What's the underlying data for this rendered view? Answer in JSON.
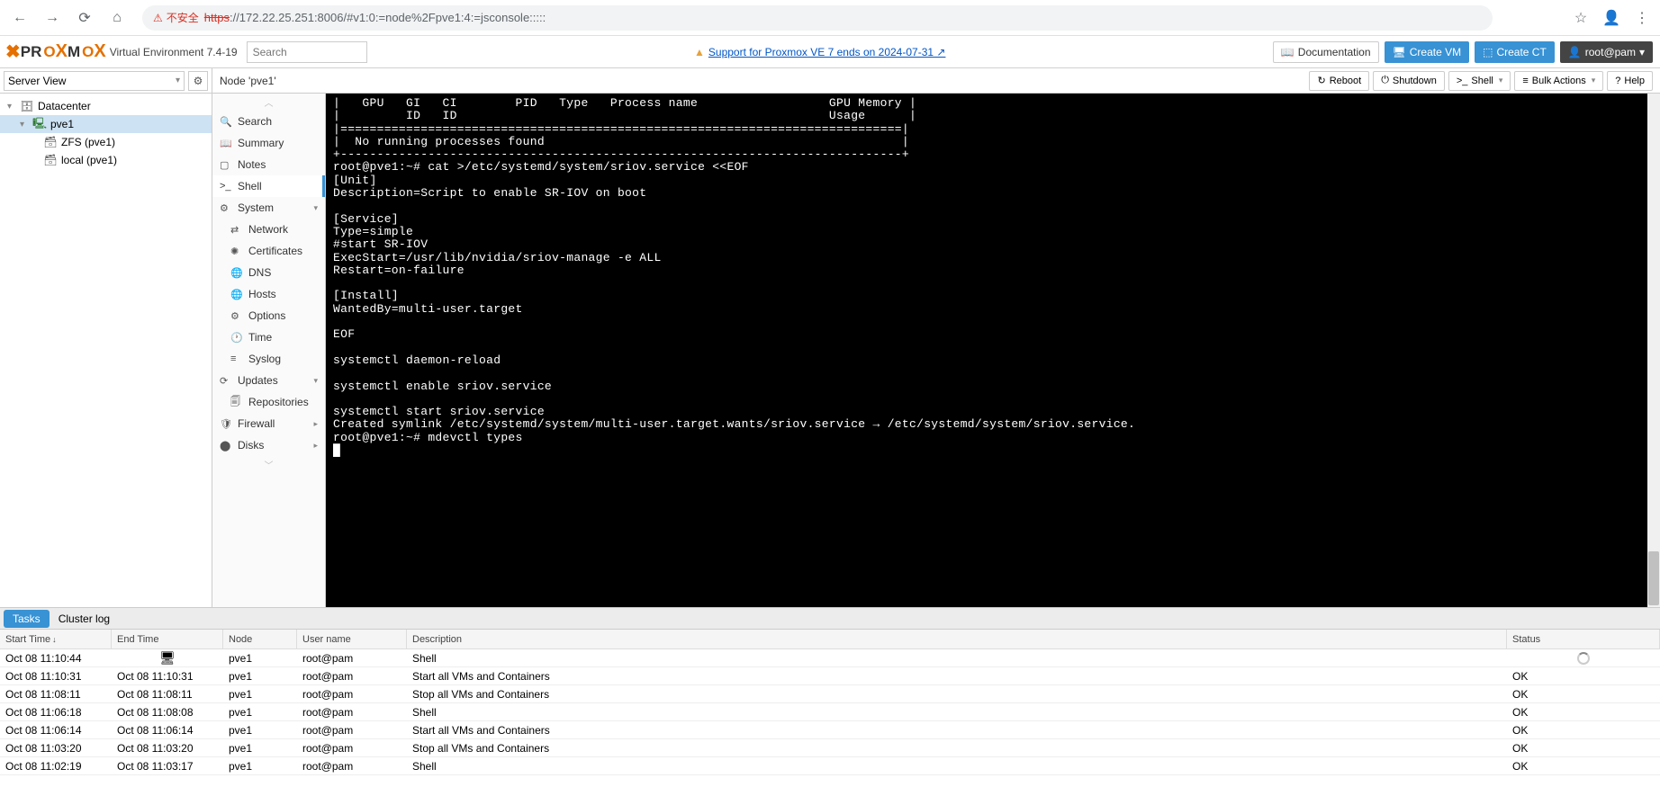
{
  "browser": {
    "insecure_label": "不安全",
    "url_scheme": "https",
    "url_rest": "://172.22.25.251:8006/#v1:0:=node%2Fpve1:4:=jsconsole:::::"
  },
  "header": {
    "logo_text_pre": "PR",
    "logo_text_o1": "O",
    "logo_text_x": "X",
    "logo_text_mid": "M",
    "logo_text_o2": "O",
    "logo_text_x2": "X",
    "product": "Virtual Environment",
    "version": "7.4-19",
    "search_placeholder": "Search",
    "support_warning": "Support for Proxmox VE 7 ends on 2024-07-31",
    "btn_docs": "Documentation",
    "btn_create_vm": "Create VM",
    "btn_create_ct": "Create CT",
    "user_label": "root@pam"
  },
  "sidebar": {
    "view_label": "Server View",
    "tree": {
      "datacenter": "Datacenter",
      "node": "pve1",
      "storage1": "ZFS (pve1)",
      "storage2": "local (pve1)"
    }
  },
  "center": {
    "title": "Node 'pve1'",
    "actions": {
      "reboot": "Reboot",
      "shutdown": "Shutdown",
      "shell": "Shell",
      "bulk": "Bulk Actions",
      "help": "Help"
    },
    "menu": {
      "search": "Search",
      "summary": "Summary",
      "notes": "Notes",
      "shell": "Shell",
      "system": "System",
      "network": "Network",
      "certificates": "Certificates",
      "dns": "DNS",
      "hosts": "Hosts",
      "options": "Options",
      "time": "Time",
      "syslog": "Syslog",
      "updates": "Updates",
      "repositories": "Repositories",
      "firewall": "Firewall",
      "disks": "Disks"
    }
  },
  "terminal": {
    "lines": "|   GPU   GI   CI        PID   Type   Process name                  GPU Memory |\n|         ID   ID                                                   Usage      |\n|=============================================================================|\n|  No running processes found                                                 |\n+-----------------------------------------------------------------------------+\nroot@pve1:~# cat >/etc/systemd/system/sriov.service <<EOF\n[Unit]\nDescription=Script to enable SR-IOV on boot\n\n[Service]\nType=simple\n#start SR-IOV\nExecStart=/usr/lib/nvidia/sriov-manage -e ALL\nRestart=on-failure\n\n[Install]\nWantedBy=multi-user.target\n\nEOF\n\nsystemctl daemon-reload\n\nsystemctl enable sriov.service\n\nsystemctl start sriov.service\nCreated symlink /etc/systemd/system/multi-user.target.wants/sriov.service → /etc/systemd/system/sriov.service.\nroot@pve1:~# mdevctl types\n█"
  },
  "log": {
    "tab_tasks": "Tasks",
    "tab_cluster": "Cluster log",
    "headers": {
      "start": "Start Time",
      "end": "End Time",
      "node": "Node",
      "user": "User name",
      "desc": "Description",
      "status": "Status"
    },
    "rows": [
      {
        "start": "Oct 08 11:10:44",
        "end": "",
        "end_icon": "monitor",
        "node": "pve1",
        "user": "root@pam",
        "desc": "Shell",
        "status": "",
        "status_icon": "spinner"
      },
      {
        "start": "Oct 08 11:10:31",
        "end": "Oct 08 11:10:31",
        "node": "pve1",
        "user": "root@pam",
        "desc": "Start all VMs and Containers",
        "status": "OK"
      },
      {
        "start": "Oct 08 11:08:11",
        "end": "Oct 08 11:08:11",
        "node": "pve1",
        "user": "root@pam",
        "desc": "Stop all VMs and Containers",
        "status": "OK"
      },
      {
        "start": "Oct 08 11:06:18",
        "end": "Oct 08 11:08:08",
        "node": "pve1",
        "user": "root@pam",
        "desc": "Shell",
        "status": "OK"
      },
      {
        "start": "Oct 08 11:06:14",
        "end": "Oct 08 11:06:14",
        "node": "pve1",
        "user": "root@pam",
        "desc": "Start all VMs and Containers",
        "status": "OK"
      },
      {
        "start": "Oct 08 11:03:20",
        "end": "Oct 08 11:03:20",
        "node": "pve1",
        "user": "root@pam",
        "desc": "Stop all VMs and Containers",
        "status": "OK"
      },
      {
        "start": "Oct 08 11:02:19",
        "end": "Oct 08 11:03:17",
        "node": "pve1",
        "user": "root@pam",
        "desc": "Shell",
        "status": "OK"
      }
    ]
  }
}
